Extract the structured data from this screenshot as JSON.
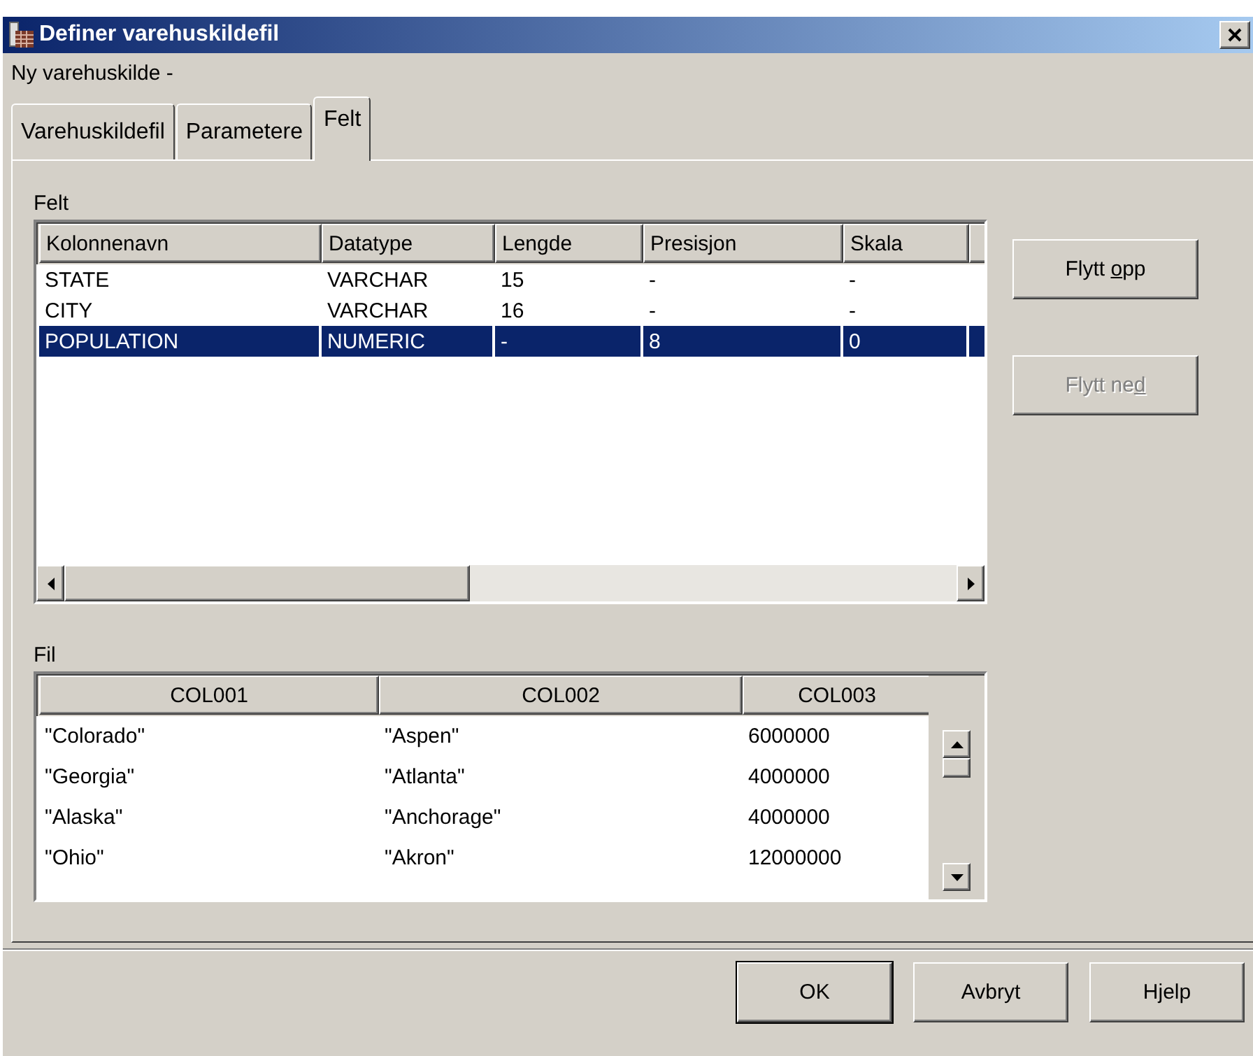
{
  "window": {
    "title": "Definer varehuskildefil"
  },
  "subtitle": "Ny varehuskilde -",
  "tabs": [
    {
      "label": "Varehuskildefil",
      "selected": false
    },
    {
      "label": "Parametere",
      "selected": false
    },
    {
      "label": "Felt",
      "selected": true
    }
  ],
  "fields": {
    "label": "Felt",
    "columns": [
      "Kolonnenavn",
      "Datatype",
      "Lengde",
      "Presisjon",
      "Skala"
    ],
    "rows": [
      {
        "cells": [
          "STATE",
          "VARCHAR",
          "15",
          "-",
          "-"
        ],
        "selected": false
      },
      {
        "cells": [
          "CITY",
          "VARCHAR",
          "16",
          "-",
          "-"
        ],
        "selected": false
      },
      {
        "cells": [
          "POPULATION",
          "NUMERIC",
          "-",
          "8",
          "0"
        ],
        "selected": true
      }
    ]
  },
  "side_buttons": [
    {
      "label_start": "Flytt ",
      "mnemonic": "o",
      "label_end": "pp",
      "disabled": false
    },
    {
      "label_start": "Flytt ne",
      "mnemonic": "d",
      "disabled": true
    }
  ],
  "file": {
    "label": "Fil",
    "columns": [
      "COL001",
      "COL002",
      "COL003"
    ],
    "rows": [
      [
        "\"Colorado\"",
        "\"Aspen\"",
        "6000000"
      ],
      [
        "\"Georgia\"",
        "\"Atlanta\"",
        "4000000"
      ],
      [
        "\"Alaska\"",
        "\"Anchorage\"",
        "4000000"
      ],
      [
        "\"Ohio\"",
        "\"Akron\"",
        "12000000"
      ]
    ]
  },
  "buttons": [
    {
      "label": "OK",
      "default": true
    },
    {
      "label": "Avbryt",
      "default": false
    },
    {
      "label": "Hjelp",
      "default": false
    }
  ]
}
